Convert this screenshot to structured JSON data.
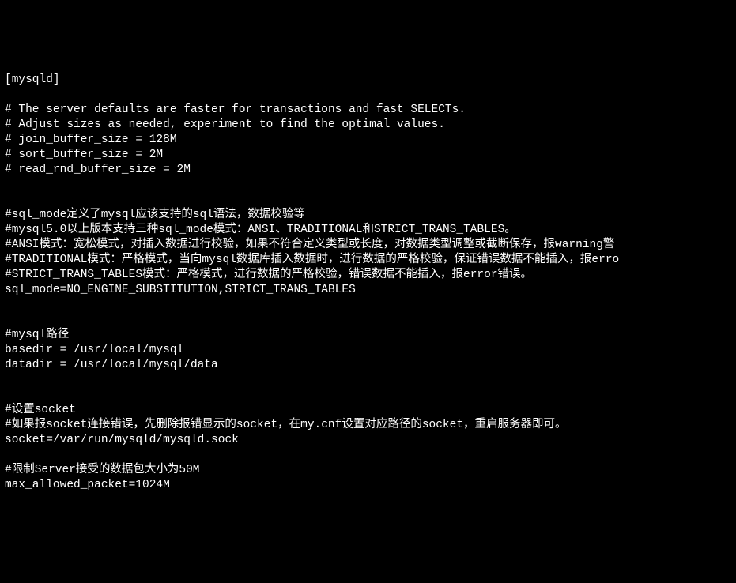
{
  "lines": [
    "[mysqld]",
    "",
    "# The server defaults are faster for transactions and fast SELECTs.",
    "# Adjust sizes as needed, experiment to find the optimal values.",
    "# join_buffer_size = 128M",
    "# sort_buffer_size = 2M",
    "# read_rnd_buffer_size = 2M",
    "",
    "",
    "#sql_mode定义了mysql应该支持的sql语法，数据校验等",
    "#mysql5.0以上版本支持三种sql_mode模式：ANSI、TRADITIONAL和STRICT_TRANS_TABLES。",
    "#ANSI模式：宽松模式，对插入数据进行校验，如果不符合定义类型或长度，对数据类型调整或截断保存，报warning警",
    "#TRADITIONAL模式：严格模式，当向mysql数据库插入数据时，进行数据的严格校验，保证错误数据不能插入，报erro",
    "#STRICT_TRANS_TABLES模式：严格模式，进行数据的严格校验，错误数据不能插入，报error错误。",
    "sql_mode=NO_ENGINE_SUBSTITUTION,STRICT_TRANS_TABLES",
    "",
    "",
    "#mysql路径",
    "basedir = /usr/local/mysql",
    "datadir = /usr/local/mysql/data",
    "",
    "",
    "#设置socket",
    "#如果报socket连接错误，先删除报错显示的socket，在my.cnf设置对应路径的socket，重启服务器即可。",
    "socket=/var/run/mysqld/mysqld.sock",
    "",
    "#限制Server接受的数据包大小为50M",
    "max_allowed_packet=1024M",
    ""
  ]
}
